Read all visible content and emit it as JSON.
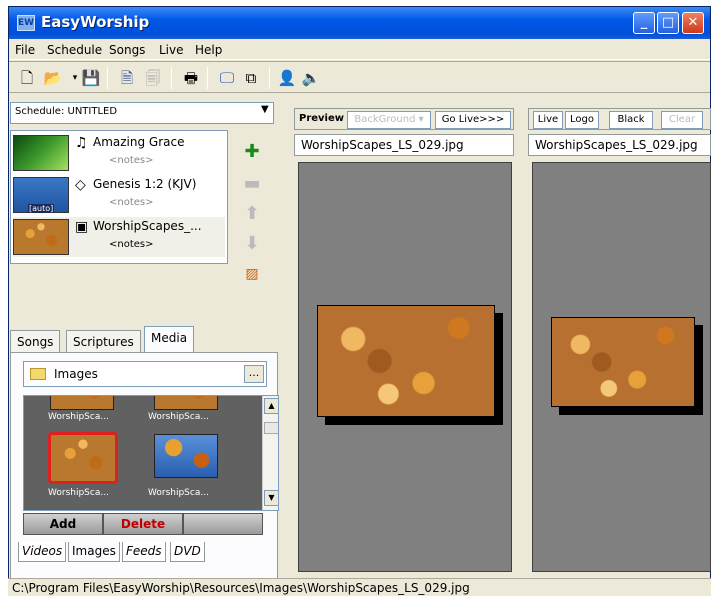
{
  "window": {
    "title": "EasyWorship",
    "icon_text": "EW",
    "min_label": "_",
    "max_label": "□",
    "close_label": "✕"
  },
  "menu": [
    "File",
    "Schedule",
    "Songs",
    "Live",
    "Help"
  ],
  "schedule": {
    "title": "Schedule: UNTITLED",
    "items": [
      {
        "title": "Amazing Grace",
        "notes": "<notes>",
        "icon": "song-icon"
      },
      {
        "title": "Genesis 1:2 (KJV)",
        "notes": "<notes>",
        "icon": "scripture-icon",
        "badge": "[auto]"
      },
      {
        "title": "WorshipScapes_...",
        "notes": "<notes>",
        "icon": "media-icon"
      }
    ]
  },
  "tabs": [
    "Songs",
    "Scriptures",
    "Media"
  ],
  "media": {
    "folder": "Images",
    "browse_label": "...",
    "thumb_label": "WorshipSca...",
    "add_label": "Add",
    "delete_label": "Delete"
  },
  "bottom_tabs": [
    "Videos",
    "Images",
    "Feeds",
    "DVD"
  ],
  "preview": {
    "label": "Preview",
    "background_label": "BackGround",
    "go_live_label": "Go Live>>>",
    "filename": "WorshipScapes_LS_029.jpg"
  },
  "live": {
    "live_label": "Live",
    "logo_label": "Logo",
    "black_label": "Black",
    "clear_label": "Clear",
    "filename": "WorshipScapes_LS_029.jpg"
  },
  "status": {
    "path": "C:\\Program Files\\EasyWorship\\Resources\\Images\\WorshipScapes_LS_029.jpg"
  },
  "colors": {
    "title_bar": "#0058e6",
    "selected_border": "#e02020",
    "delete_text": "#c00000"
  }
}
